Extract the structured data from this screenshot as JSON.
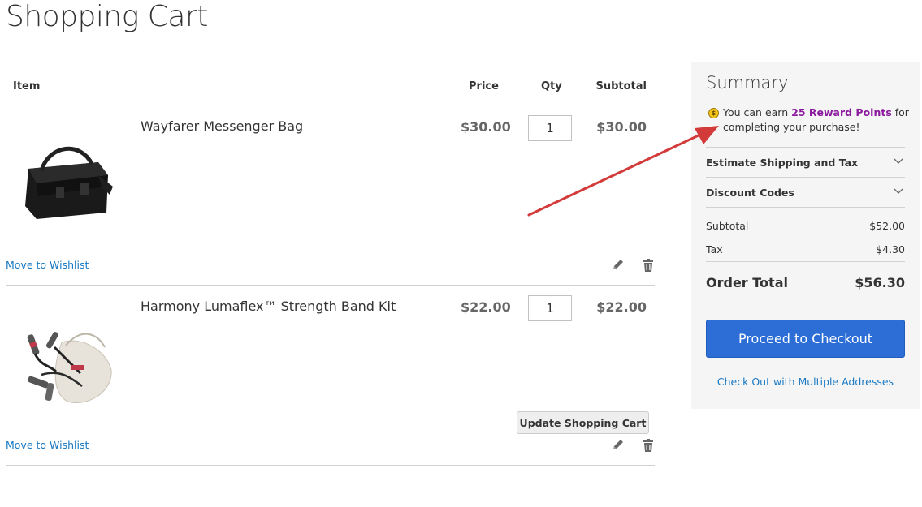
{
  "page": {
    "title": "Shopping Cart"
  },
  "cart": {
    "headers": {
      "item": "Item",
      "price": "Price",
      "qty": "Qty",
      "subtotal": "Subtotal"
    },
    "items": [
      {
        "name": "Wayfarer Messenger Bag",
        "price": "$30.00",
        "qty": "1",
        "subtotal": "$30.00",
        "wishlist_label": "Move to Wishlist",
        "image_icon": "messenger-bag-image"
      },
      {
        "name": "Harmony Lumaflex™ Strength Band Kit",
        "price": "$22.00",
        "qty": "1",
        "subtotal": "$22.00",
        "wishlist_label": "Move to Wishlist",
        "image_icon": "strength-band-kit-image"
      }
    ],
    "update_label": "Update Shopping Cart"
  },
  "summary": {
    "title": "Summary",
    "reward_prefix": "You can earn ",
    "reward_points": "25 Reward Points",
    "reward_suffix": " for completing your purchase!",
    "reward_coin": "$",
    "estimate_label": "Estimate Shipping and Tax",
    "discount_label": "Discount Codes",
    "subtotal_label": "Subtotal",
    "subtotal_value": "$52.00",
    "tax_label": "Tax",
    "tax_value": "$4.30",
    "order_total_label": "Order Total",
    "order_total_value": "$56.30",
    "checkout_label": "Proceed to Checkout",
    "multi_label": "Check Out with Multiple Addresses"
  },
  "colors": {
    "link": "#1979c3",
    "checkout": "#2c6ed5",
    "points": "#8b1a9e",
    "arrow": "#d33b3b",
    "summary_bg": "#f5f5f5"
  }
}
